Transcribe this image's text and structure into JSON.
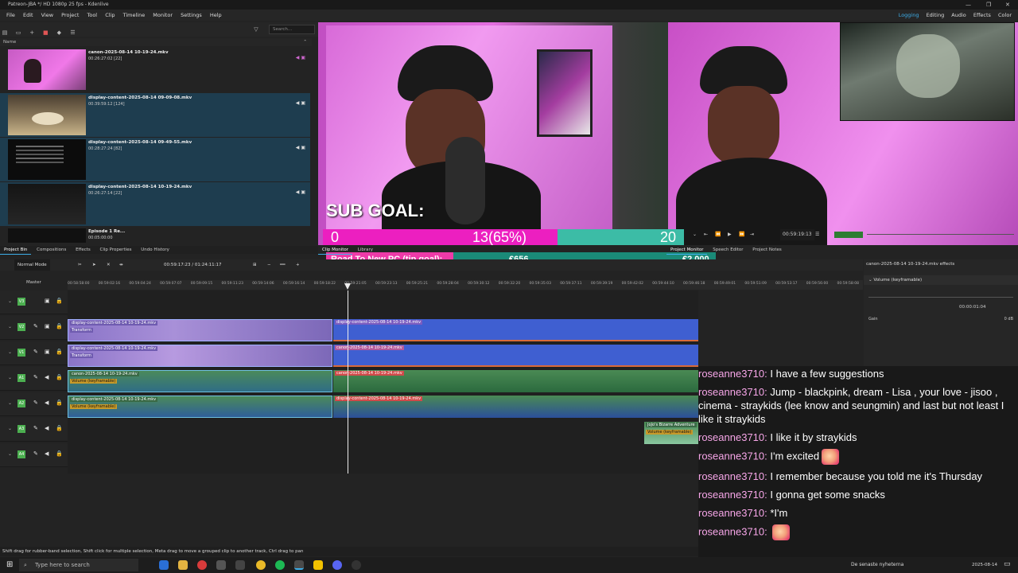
{
  "window": {
    "title": "Patreon-JBA */ HD 1080p 25 fps - Kdenlive"
  },
  "menu": [
    "File",
    "Edit",
    "View",
    "Project",
    "Tool",
    "Clip",
    "Timeline",
    "Monitor",
    "Settings",
    "Help"
  ],
  "layouts": [
    "Logging",
    "Editing",
    "Audio",
    "Effects",
    "Color"
  ],
  "bin": {
    "search_placeholder": "Search...",
    "name_header": "Name",
    "clips": [
      {
        "name": "canon-2025-08-14 10-19-24.mkv",
        "duration": "00:26:27:02 [22]"
      },
      {
        "name": "display-content-2025-08-14 09-09-08.mkv",
        "duration": "00:39:59:12 [124]"
      },
      {
        "name": "display-content-2025-08-14 09-49-55.mkv",
        "duration": "00:28:27:24 [82]"
      },
      {
        "name": "display-content-2025-08-14 10-19-24.mkv",
        "duration": "00:26:27:14 [22]"
      },
      {
        "name": "Episode 1 Re...",
        "duration": "00:05:00:00"
      }
    ],
    "tabs": [
      "Project Bin",
      "Compositions",
      "Effects",
      "Clip Properties",
      "Undo History"
    ]
  },
  "monitor_tabs": {
    "left": [
      "Clip Monitor",
      "Library"
    ],
    "right": [
      "Project Monitor",
      "Speech Editor",
      "Project Notes"
    ]
  },
  "overlay": {
    "sub_goal": "SUB GOAL:",
    "sub_start": "0",
    "sub_current": "13(65%)",
    "sub_target": "20",
    "sub_progress": 0.65,
    "tip_label": "Road To New PC (tip goal):",
    "tip_current": "€656",
    "tip_target": "€2.000"
  },
  "project_monitor": {
    "timecode": "00:59:19:13"
  },
  "timeline": {
    "mode": "Normal Mode",
    "timecode": "00:59:17:23 / 01:24:11:17",
    "master": "Master",
    "ruler": [
      "00:58:58:00",
      "00:59:02:16",
      "00:59:04:24",
      "00:59:07:07",
      "00:59:09:15",
      "00:59:11:23",
      "00:59:14:06",
      "00:59:16:14",
      "00:59:18:22",
      "00:59:21:05",
      "00:59:23:13",
      "00:59:25:21",
      "00:59:28:04",
      "00:59:30:12",
      "00:59:32:20",
      "00:59:35:03",
      "00:59:37:11",
      "00:59:39:19",
      "00:59:42:02",
      "00:59:44:10",
      "00:59:46:18",
      "00:59:49:01",
      "00:59:51:09",
      "00:59:53:17",
      "00:59:56:00",
      "00:59:58:08"
    ],
    "tracks": [
      {
        "badge": "V3",
        "kind": "video"
      },
      {
        "badge": "V2",
        "kind": "video"
      },
      {
        "badge": "V1",
        "kind": "video"
      },
      {
        "badge": "A1",
        "kind": "audio"
      },
      {
        "badge": "A2",
        "kind": "audio"
      },
      {
        "badge": "A3",
        "kind": "audio"
      },
      {
        "badge": "A4",
        "kind": "audio"
      }
    ],
    "clip_labels": {
      "v2a": "display-content-2025-08-14 10-19-24.mkv",
      "v2b": "display-content-2025-08-14 10-19-24.mkv",
      "v1a": "display-content-2025-08-14 10-19-24.mkv",
      "v1b": "canon-2025-08-14 10-19-24.mkv",
      "a1a": "canon-2025-08-14 10-19-24.mkv",
      "a1b": "canon-2025-08-14 10-19-24.mkv",
      "a2a": "display-content-2025-08-14 10-19-24.mkv",
      "a2b": "display-content-2025-08-14 10-19-24.mkv",
      "a3": "JoJo's Bizarre Adventure",
      "transform": "Transform",
      "volume": "Volume (keyframable)"
    }
  },
  "effects_panel": {
    "title": "canon-2025-08-14 10-19-24.mkv effects",
    "effect": "Volume (keyframable)",
    "timecode": "00:00:01:04",
    "param": "Gain",
    "value": "0 dB"
  },
  "chat": [
    {
      "user": "roseanne3710:",
      "text": "I have a few suggestions",
      "emote": false
    },
    {
      "user": "roseanne3710:",
      "text": "Jump - blackpink, dream - Lisa , your love - jisoo , cinema - straykids (lee know and seungmin) and last but not least I like it straykids",
      "emote": false
    },
    {
      "user": "roseanne3710:",
      "text": "I like it by straykids",
      "emote": false
    },
    {
      "user": "roseanne3710:",
      "text": "I'm excited",
      "emote": true
    },
    {
      "user": "roseanne3710:",
      "text": "I remember because you told me it's Thursday",
      "emote": false
    },
    {
      "user": "roseanne3710:",
      "text": "I gonna get some snacks",
      "emote": false
    },
    {
      "user": "roseanne3710:",
      "text": "*I'm",
      "emote": false
    },
    {
      "user": "roseanne3710:",
      "text": "",
      "emote": true
    }
  ],
  "statusbar": {
    "hint": "Shift drag for rubber-band selection, Shift click for multiple selection, Meta drag to move a grouped clip to another track, Ctrl drag to pan"
  },
  "taskbar": {
    "search_placeholder": "Type here to search",
    "news": "De senaste nyheterna",
    "date": "2025-08-14"
  }
}
